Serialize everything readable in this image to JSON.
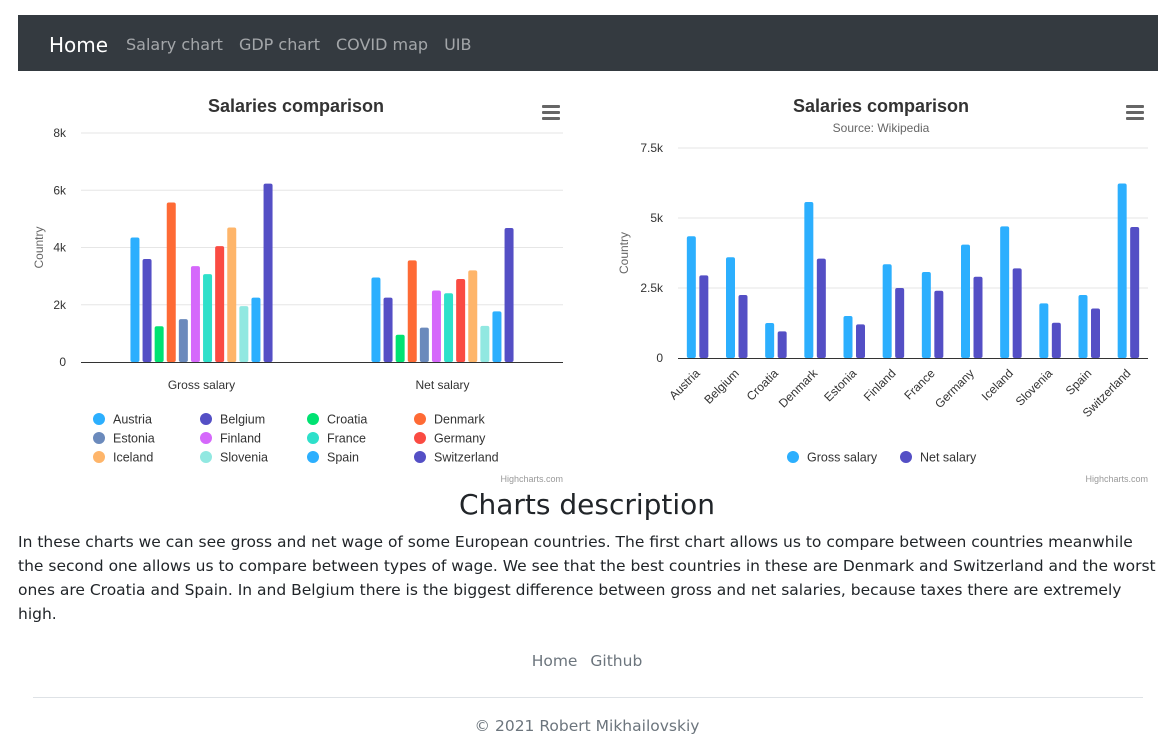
{
  "nav": {
    "brand": "Home",
    "links": [
      "Salary chart",
      "GDP chart",
      "COVID map",
      "UIB"
    ]
  },
  "colors": {
    "navbar_bg": "#343a40",
    "gross": "#2caffe",
    "net": "#544fc5"
  },
  "credits": "Highcharts.com",
  "chart_data": [
    {
      "type": "bar",
      "title": "Salaries comparison",
      "subtitle": "",
      "ylabel": "Country",
      "xlabel": "",
      "categories": [
        "Gross salary",
        "Net salary"
      ],
      "ylim": [
        0,
        8000
      ],
      "yticks": [
        "0",
        "2k",
        "4k",
        "6k",
        "8k"
      ],
      "ytick_values": [
        0,
        2000,
        4000,
        6000,
        8000
      ],
      "grid": true,
      "legend_position": "bottom",
      "series": [
        {
          "name": "Austria",
          "color": "#2caffe",
          "values": [
            4350,
            2950
          ]
        },
        {
          "name": "Belgium",
          "color": "#544fc5",
          "values": [
            3600,
            2250
          ]
        },
        {
          "name": "Croatia",
          "color": "#00e272",
          "values": [
            1250,
            950
          ]
        },
        {
          "name": "Denmark",
          "color": "#fe6a35",
          "values": [
            5570,
            3550
          ]
        },
        {
          "name": "Estonia",
          "color": "#6b8abc",
          "values": [
            1500,
            1200
          ]
        },
        {
          "name": "Finland",
          "color": "#d568fb",
          "values": [
            3350,
            2500
          ]
        },
        {
          "name": "France",
          "color": "#2ee0ca",
          "values": [
            3070,
            2400
          ]
        },
        {
          "name": "Germany",
          "color": "#fa4b42",
          "values": [
            4050,
            2900
          ]
        },
        {
          "name": "Iceland",
          "color": "#feb56a",
          "values": [
            4700,
            3200
          ]
        },
        {
          "name": "Slovenia",
          "color": "#91e8e1",
          "values": [
            1950,
            1260
          ]
        },
        {
          "name": "Spain",
          "color": "#2caffe",
          "values": [
            2250,
            1770
          ]
        },
        {
          "name": "Switzerland",
          "color": "#544fc5",
          "values": [
            6230,
            4680
          ]
        }
      ]
    },
    {
      "type": "bar",
      "title": "Salaries comparison",
      "subtitle": "Source: Wikipedia",
      "ylabel": "Country",
      "xlabel": "",
      "categories": [
        "Austria",
        "Belgium",
        "Croatia",
        "Denmark",
        "Estonia",
        "Finland",
        "France",
        "Germany",
        "Iceland",
        "Slovenia",
        "Spain",
        "Switzerland"
      ],
      "ylim": [
        0,
        7500
      ],
      "yticks": [
        "0",
        "2.5k",
        "5k",
        "7.5k"
      ],
      "ytick_values": [
        0,
        2500,
        5000,
        7500
      ],
      "grid": true,
      "legend_position": "bottom",
      "series": [
        {
          "name": "Gross salary",
          "color": "#2caffe",
          "values": [
            4350,
            3600,
            1250,
            5570,
            1500,
            3350,
            3070,
            4050,
            4700,
            1950,
            2250,
            6230
          ]
        },
        {
          "name": "Net salary",
          "color": "#544fc5",
          "values": [
            2950,
            2250,
            950,
            3550,
            1200,
            2500,
            2400,
            2900,
            3200,
            1260,
            1770,
            4680
          ]
        }
      ]
    }
  ],
  "description": {
    "title": "Charts description",
    "text": "In these charts we can see gross and net wage of some European countries. The first chart allows us to compare between countries meanwhile the second one allows us to compare between types of wage. We see that the best countries in these are Denmark and Switzerland and the worst ones are Croatia and Spain. In and Belgium there is the biggest difference between gross and net salaries, because taxes there are extremely high."
  },
  "footer": {
    "links": [
      "Home",
      "Github"
    ],
    "copyright": "© 2021 Robert Mikhailovskiy"
  }
}
